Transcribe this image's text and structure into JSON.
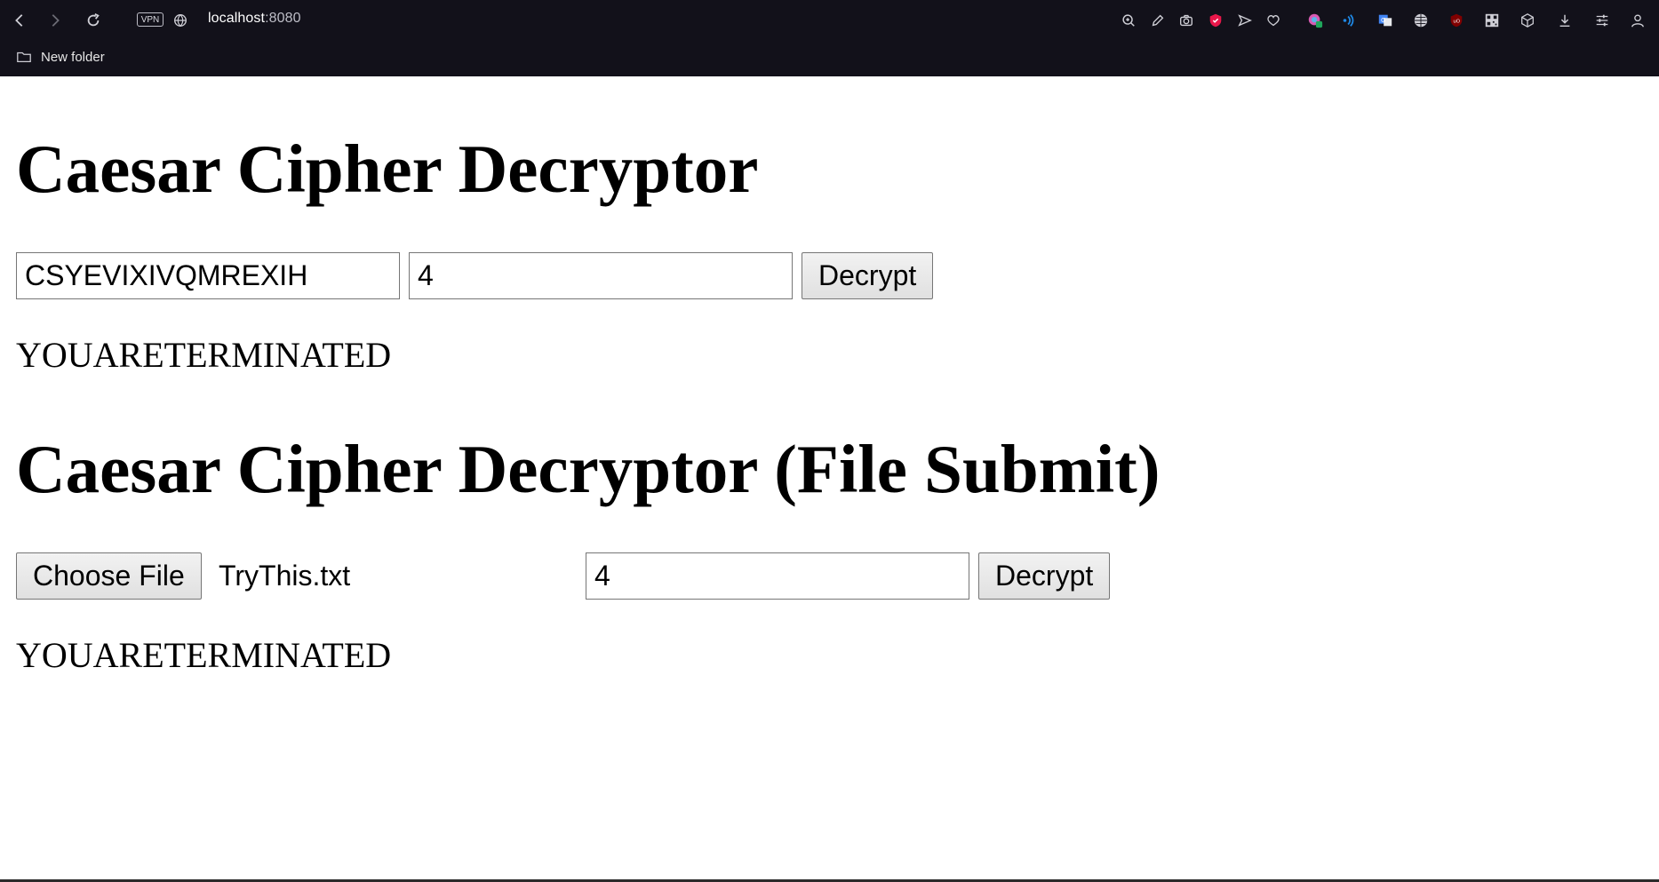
{
  "browser": {
    "url_host": "localhost",
    "url_port": ":8080",
    "vpn_label": "VPN",
    "bookmarks": [
      {
        "label": "New folder"
      }
    ],
    "toolbar_icons": [
      "back-icon",
      "forward-icon",
      "reload-icon",
      "zoom-icon",
      "edit-icon",
      "camera-icon",
      "shield-icon",
      "send-icon",
      "heart-icon",
      "extension-icon",
      "speaker-icon",
      "translate-icon",
      "globe-icon",
      "ublock-icon",
      "qr-icon",
      "box-icon",
      "download-icon",
      "sliders-icon",
      "profile-icon"
    ]
  },
  "text_section": {
    "title": "Caesar Cipher Decryptor",
    "cipher_value": "CSYEVIXIVQMREXIH",
    "shift_value": "4",
    "decrypt_label": "Decrypt",
    "result": "YOUARETERMINATED"
  },
  "file_section": {
    "title": "Caesar Cipher Decryptor (File Submit)",
    "choose_file_label": "Choose File",
    "file_name": "TryThis.txt",
    "shift_value": "4",
    "decrypt_label": "Decrypt",
    "result": "YOUARETERMINATED"
  },
  "colors": {
    "chrome_bg": "#12111a",
    "page_bg": "#ffffff"
  }
}
